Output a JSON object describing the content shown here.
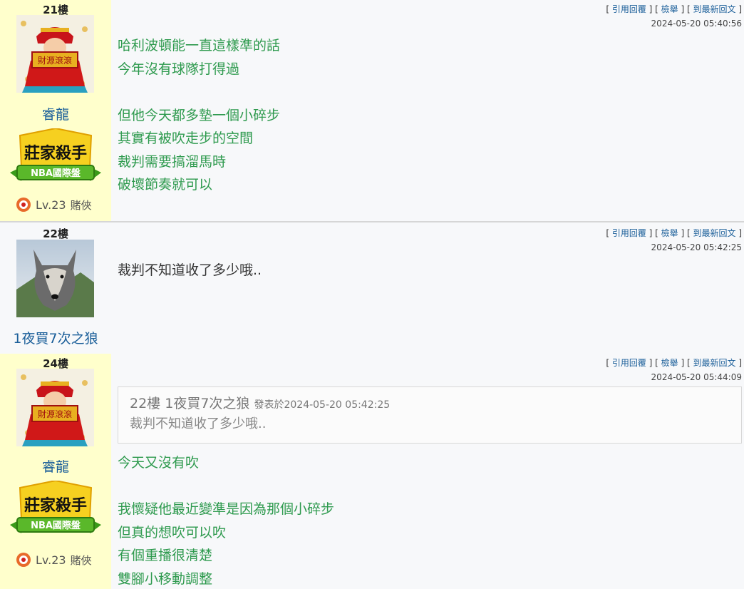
{
  "actions": {
    "quote": "引用回覆",
    "report": "檢舉",
    "latest": "到最新回文"
  },
  "posts": [
    {
      "floor": "21樓",
      "user": "睿龍",
      "badge": {
        "line1": "莊家殺手",
        "line2": "NBA國際盤"
      },
      "level": "Lv.23",
      "title": "賭俠",
      "time": "2024-05-20 05:40:56",
      "lines": [
        "哈利波頓能一直這樣準的話",
        "今年沒有球隊打得過",
        "",
        "但他今天都多墊一個小碎步",
        "其實有被吹走步的空間",
        "裁判需要搞溜馬時",
        "破壞節奏就可以"
      ]
    },
    {
      "floor": "22樓",
      "user": "1夜買7次之狼",
      "time": "2024-05-20 05:42:25",
      "lines": [
        "裁判不知道收了多少哦.."
      ]
    },
    {
      "floor": "24樓",
      "user": "睿龍",
      "badge": {
        "line1": "莊家殺手",
        "line2": "NBA國際盤"
      },
      "level": "Lv.23",
      "title": "賭俠",
      "time": "2024-05-20 05:44:09",
      "quote": {
        "floor": "22樓",
        "user": "1夜買7次之狼",
        "posted": "發表於",
        "time": "2024-05-20 05:42:25",
        "text": "裁判不知道收了多少哦.."
      },
      "lines": [
        "今天又沒有吹",
        "",
        "我懷疑他最近變準是因為那個小碎步",
        "但真的想吹可以吹",
        "有個重播很清楚",
        "雙腳小移動調整"
      ]
    }
  ],
  "colors": {
    "sidebar": "#ffffcc",
    "green_text": "#2e9a4e",
    "username": "#1a5e99"
  }
}
